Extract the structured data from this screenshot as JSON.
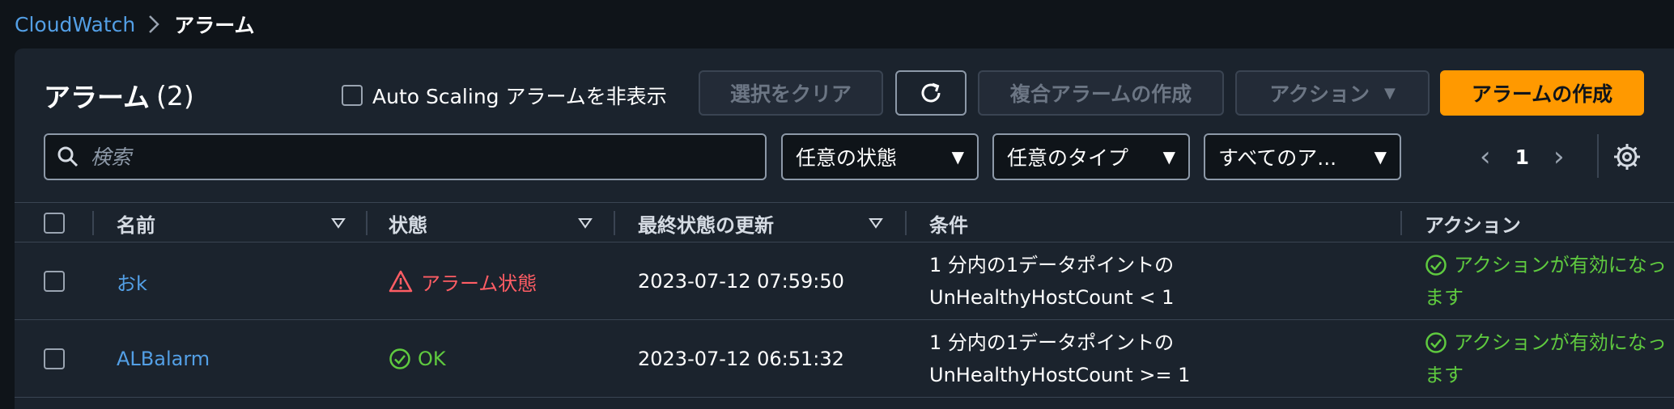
{
  "breadcrumb": {
    "root": "CloudWatch",
    "current": "アラーム"
  },
  "header": {
    "title": "アラーム",
    "count": "(2)",
    "hide_autoscaling_label": "Auto Scaling アラームを非表示",
    "clear_selection": "選択をクリア",
    "create_composite": "複合アラームの作成",
    "actions": "アクション",
    "create_alarm": "アラームの作成"
  },
  "filters": {
    "search_placeholder": "検索",
    "state": "任意の状態",
    "type": "任意のタイプ",
    "actions_filter": "すべてのア..."
  },
  "pagination": {
    "page": "1"
  },
  "table": {
    "columns": [
      "名前",
      "状態",
      "最終状態の更新",
      "条件",
      "アクション"
    ],
    "rows": [
      {
        "name": "おk",
        "state": "アラーム状態",
        "updated": "2023-07-12 07:59:50",
        "condition_line1": "1 分内の1データポイントの",
        "condition_line2": "UnHealthyHostCount < 1",
        "action_line1": "アクションが有効になっ",
        "action_line2": "ます"
      },
      {
        "name": "ALBalarm",
        "state": "OK",
        "updated": "2023-07-12 06:51:32",
        "condition_line1": "1 分内の1データポイントの",
        "condition_line2": "UnHealthyHostCount >= 1",
        "action_line1": "アクションが有効になっ",
        "action_line2": "ます"
      }
    ]
  },
  "colors": {
    "link": "#539fe5",
    "primary": "#ff9900",
    "alarm": "#ff5d64",
    "ok": "#5fca3f",
    "panel": "#1b232d"
  }
}
